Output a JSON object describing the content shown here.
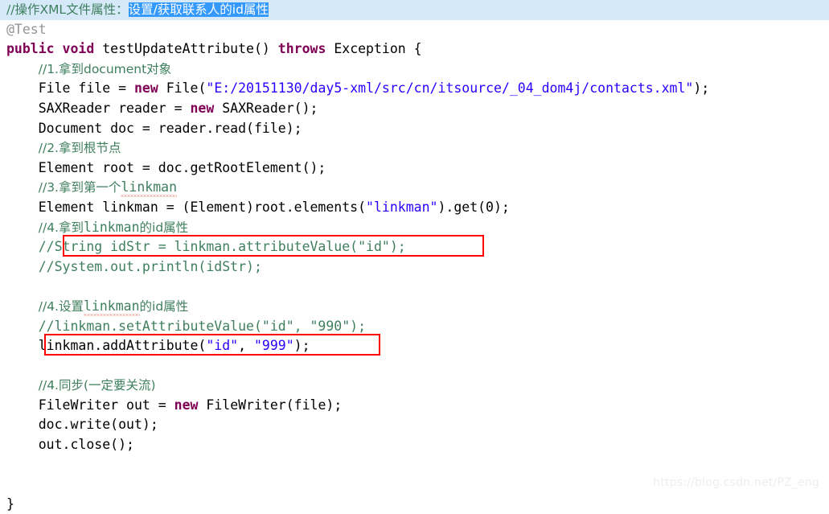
{
  "editor": {
    "language": "java",
    "watermark": "https://blog.csdn.net/PZ_eng",
    "colors": {
      "background": "#ffffff",
      "keyword": "#7f0055",
      "comment": "#3f7f5f",
      "string": "#2a00ff",
      "annotation": "#949494",
      "plain": "#000000",
      "current_line_highlight": "#d6e9f8",
      "selection_background": "#3399ff",
      "selection_foreground": "#ffffff",
      "annotation_box_border": "#ff0000",
      "spellcheck_squiggle": "#e06c5a"
    }
  },
  "lines": {
    "l1_comment_prefix": "//操作XML文件属性：",
    "l1_selected": "设置/获取联系人的id属性",
    "l2_annotation": "@Test",
    "l3_kw_public": "public",
    "l3_kw_void": "void",
    "l3_signature": " testUpdateAttribute() ",
    "l3_kw_throws": "throws",
    "l3_tail": " Exception {",
    "l4_comment": "//1.拿到document对象",
    "l5_a": "File file = ",
    "l5_kw_new": "new",
    "l5_b": " File(",
    "l5_str": "\"E:/20151130/day5-xml/src/cn/itsource/_04_dom4j/contacts.xml\"",
    "l5_c": ");",
    "l6_a": "SAXReader reader = ",
    "l6_kw_new": "new",
    "l6_b": " SAXReader();",
    "l7": "Document doc = reader.read(file);",
    "l8_comment": "//2.拿到根节点",
    "l9": "Element root = doc.getRootElement();",
    "l10_comment_a": "//3.拿到第一个",
    "l10_comment_word": "linkman",
    "l11_a": "Element linkman = (Element)root.elements(",
    "l11_str": "\"linkman\"",
    "l11_b": ").get(0);",
    "l12_comment_a": "//4.拿到",
    "l12_comment_word": "linkman",
    "l12_comment_b": "的id属性",
    "l13_comment": "//String idStr = linkman.attributeValue(\"id\");",
    "l14_comment": "//System.out.println(idStr);",
    "l15": "",
    "l16_comment_a": "//4.设置",
    "l16_comment_word": "linkman",
    "l16_comment_b": "的id属性",
    "l17_comment": "//linkman.setAttributeValue(\"id\", \"990\");",
    "l18_a": "linkman.addAttribute(",
    "l18_str1": "\"id\"",
    "l18_mid": ", ",
    "l18_str2": "\"999\"",
    "l18_b": ");",
    "l19": "",
    "l20_comment": "//4.同步(一定要关流)",
    "l21_a": "FileWriter out = ",
    "l21_kw_new": "new",
    "l21_b": " FileWriter(file);",
    "l22": "doc.write(out);",
    "l23": "out.close();",
    "l24": "",
    "l25": "",
    "l26_close_brace": "}"
  },
  "annotations": {
    "box_1_label": "highlight-attributeValue-line",
    "box_2_label": "highlight-addAttribute-line"
  }
}
